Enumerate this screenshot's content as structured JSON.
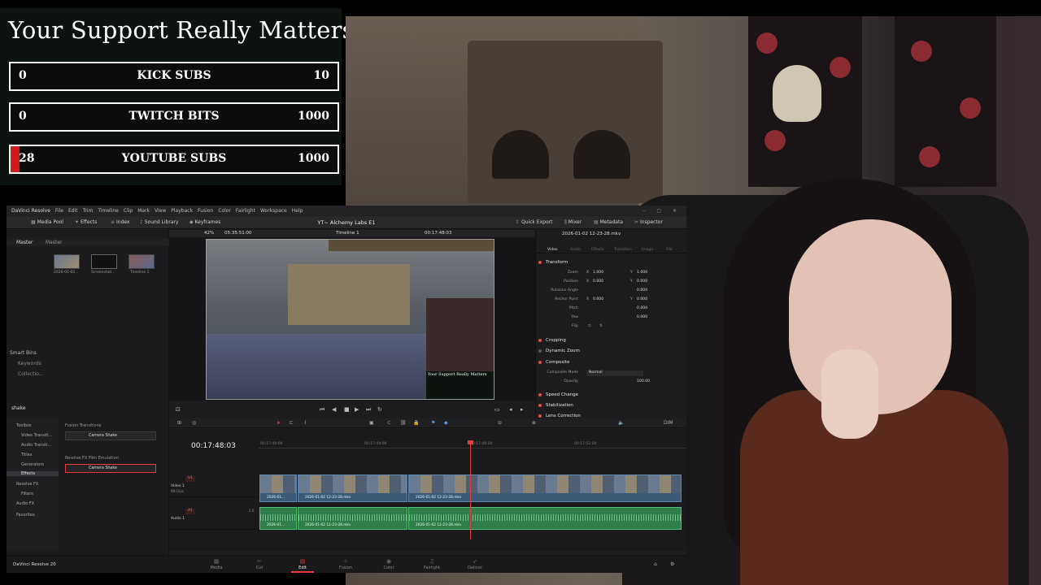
{
  "overlay": {
    "title": "Your Support Really Matters",
    "goals": [
      {
        "current": "0",
        "label": "KICK SUBS",
        "max": "10",
        "progress": 0
      },
      {
        "current": "0",
        "label": "TWITCH BITS",
        "max": "1000",
        "progress": 0
      },
      {
        "current": "28",
        "label": "YOUTUBE SUBS",
        "max": "1000",
        "progress": 0.028
      }
    ]
  },
  "resolve": {
    "app_name": "DaVinci Resolve",
    "menu": [
      "File",
      "Edit",
      "Trim",
      "Timeline",
      "Clip",
      "Mark",
      "View",
      "Playback",
      "Fusion",
      "Color",
      "Fairlight",
      "Workspace",
      "Help"
    ],
    "toolbar": {
      "media_pool": "Media Pool",
      "effects": "Effects",
      "index": "Index",
      "sound_library": "Sound Library",
      "keyframes": "Keyframes",
      "project_title": "YT~ Alchemy Labs E1",
      "quick_export": "Quick Export",
      "mixer": "Mixer",
      "metadata": "Metadata",
      "inspector": "Inspector"
    },
    "media_pool": {
      "tabs": [
        "Master",
        "Master"
      ],
      "clips": [
        {
          "name": "2026-01-02..."
        },
        {
          "name": "Screenshot..."
        },
        {
          "name": "Timeline 1"
        }
      ],
      "smart_bins": "Smart Bins",
      "smart_items": [
        "Keywords",
        "Collectio..."
      ]
    },
    "effects": {
      "search": "shake",
      "tree": [
        "Toolbox",
        "Video Transiti...",
        "Audio Transit...",
        "Titles",
        "Generators",
        "Effects",
        "Resolve FX",
        "Filters",
        "Audio FX",
        "Favorites"
      ],
      "selected_tree": "Effects",
      "groups": [
        {
          "heading": "Fusion Transitions",
          "item": "Camera Shake"
        },
        {
          "heading": "Resolve FX Film Emulation",
          "item": "Camera Shake"
        }
      ]
    },
    "viewer": {
      "zoom": "42%",
      "source_tc": "05:35:51:00",
      "timeline_name": "Timeline 1",
      "timecode": "00:17:48:03",
      "mini_title": "Your Support Really Matters"
    },
    "inspector": {
      "file": "2026-01-02 12-23-28.mkv",
      "tabs": [
        "Video",
        "Audio",
        "Effects",
        "Transition",
        "Image",
        "File"
      ],
      "transform": "Transform",
      "rows": [
        {
          "label": "Zoom",
          "x": "1.000",
          "y": "1.000"
        },
        {
          "label": "Position",
          "x": "0.000",
          "y": "0.000"
        },
        {
          "label": "Rotation Angle",
          "x": "",
          "y": "0.000"
        },
        {
          "label": "Anchor Point",
          "x": "0.000",
          "y": "0.000"
        },
        {
          "label": "Pitch",
          "x": "",
          "y": "0.000"
        },
        {
          "label": "Yaw",
          "x": "",
          "y": "0.000"
        },
        {
          "label": "Flip",
          "x": "",
          "y": ""
        }
      ],
      "sections": [
        "Cropping",
        "Dynamic Zoom",
        "Composite",
        "Speed Change",
        "Stabilization",
        "Lens Correction"
      ],
      "composite_mode_label": "Composite Mode",
      "composite_mode": "Normal",
      "opacity_label": "Opacity",
      "opacity": "100.00"
    },
    "timeline": {
      "timecode": "00:17:48:03",
      "ruler": [
        "00:17:40:00",
        "00:17:44:00",
        "00:17:48:00",
        "00:17:52:00"
      ],
      "video_track": {
        "tag": "V1",
        "name": "Video 1",
        "sub": "98 Clips"
      },
      "audio_track": {
        "tag": "A1",
        "name": "Audio 1",
        "level": "2.0"
      },
      "clips": [
        "2026-01...",
        "2026-01-02 12-23-28.mkv",
        "2026-01-02 12-23-28.mkv"
      ],
      "dim": "DIM"
    },
    "pages": [
      "Media",
      "Cut",
      "Edit",
      "Fusion",
      "Color",
      "Fairlight",
      "Deliver"
    ],
    "active_page": "Edit",
    "brand": "DaVinci Resolve 20"
  }
}
